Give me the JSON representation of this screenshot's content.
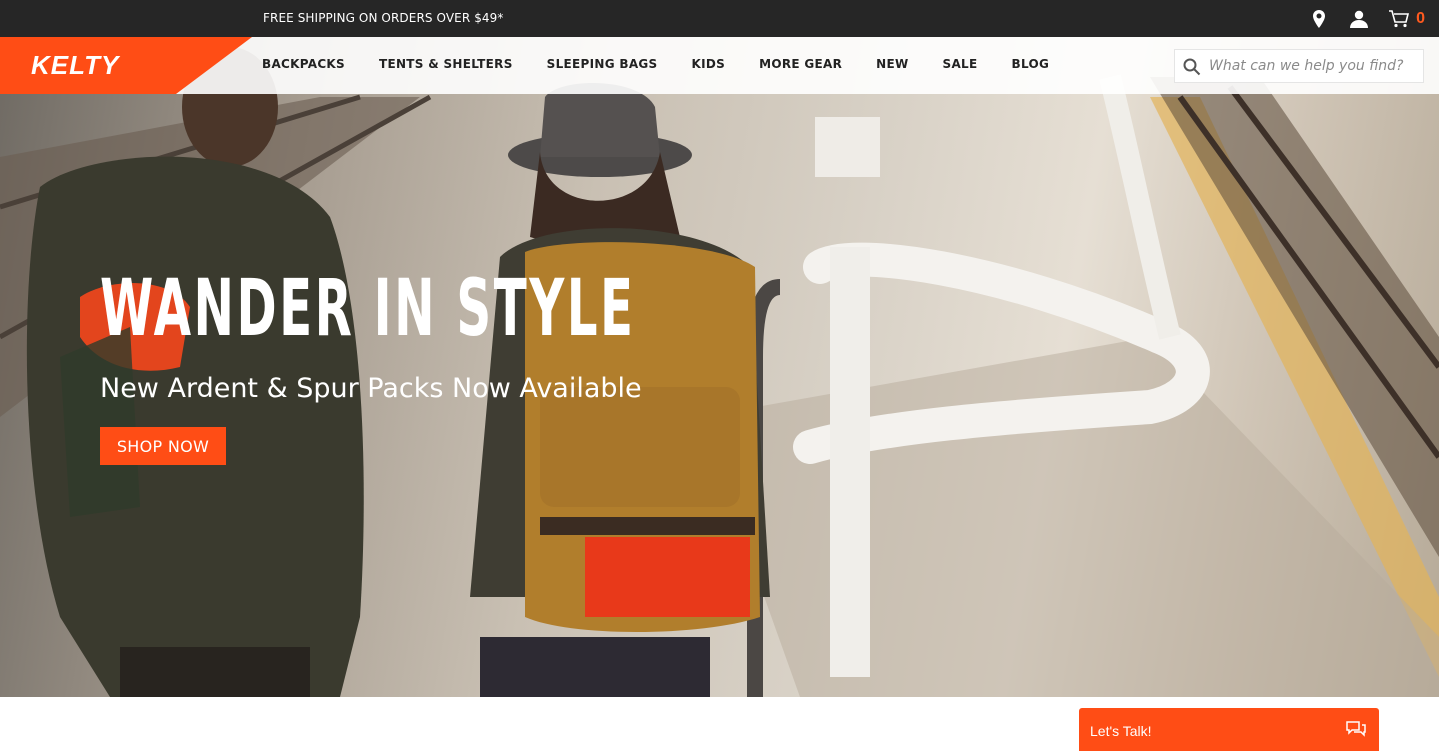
{
  "promo_bar": {
    "text": "FREE SHIPPING ON ORDERS OVER $49*"
  },
  "cart": {
    "count": "0"
  },
  "brand": {
    "logo": "KELTY",
    "accent": "#ff4d15"
  },
  "nav": {
    "items": [
      "BACKPACKS",
      "TENTS & SHELTERS",
      "SLEEPING BAGS",
      "KIDS",
      "MORE GEAR",
      "NEW",
      "SALE",
      "BLOG"
    ]
  },
  "search": {
    "placeholder": "What can we help you find?",
    "icon": "search-icon"
  },
  "hero": {
    "headline": "WANDER IN STYLE",
    "subhead": "New Ardent & Spur Packs Now Available",
    "cta": "SHOP NOW"
  },
  "chat": {
    "label": "Let's Talk!",
    "icon": "chat-bubbles-icon"
  },
  "icons": [
    "location-pin-icon",
    "account-icon",
    "cart-icon"
  ]
}
